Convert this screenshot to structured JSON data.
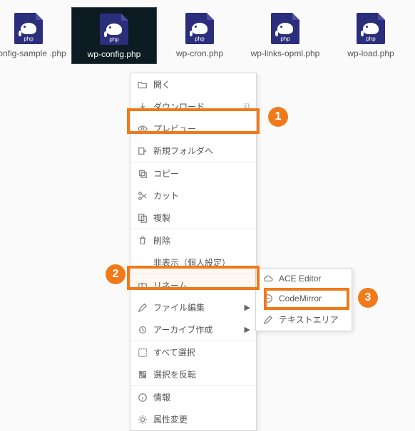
{
  "files": [
    {
      "name": "-config-sample\n.php",
      "ext": "php",
      "selected": false
    },
    {
      "name": "wp-config.php",
      "ext": "php",
      "selected": true
    },
    {
      "name": "wp-cron.php",
      "ext": "php",
      "selected": false
    },
    {
      "name": "wp-links-opml.php",
      "ext": "php",
      "selected": false
    },
    {
      "name": "wp-load.php",
      "ext": "php",
      "selected": false
    }
  ],
  "menu": {
    "open": "開く",
    "download": "ダウンロード",
    "preview": "プレビュー",
    "newfolder": "新規フォルダへ",
    "copy": "コピー",
    "cut": "カット",
    "duplicate": "複製",
    "delete": "削除",
    "hide": "非表示（個人設定）",
    "rename": "リネーム",
    "editfile": "ファイル編集",
    "archive": "アーカイブ作成",
    "selectall": "すべて選択",
    "invert": "選択を反転",
    "info": "情報",
    "chmod": "属性変更"
  },
  "submenu": {
    "ace": "ACE Editor",
    "cm": "CodeMirror",
    "text": "テキストエリア"
  },
  "badges": {
    "b1": "1",
    "b2": "2",
    "b3": "3"
  }
}
